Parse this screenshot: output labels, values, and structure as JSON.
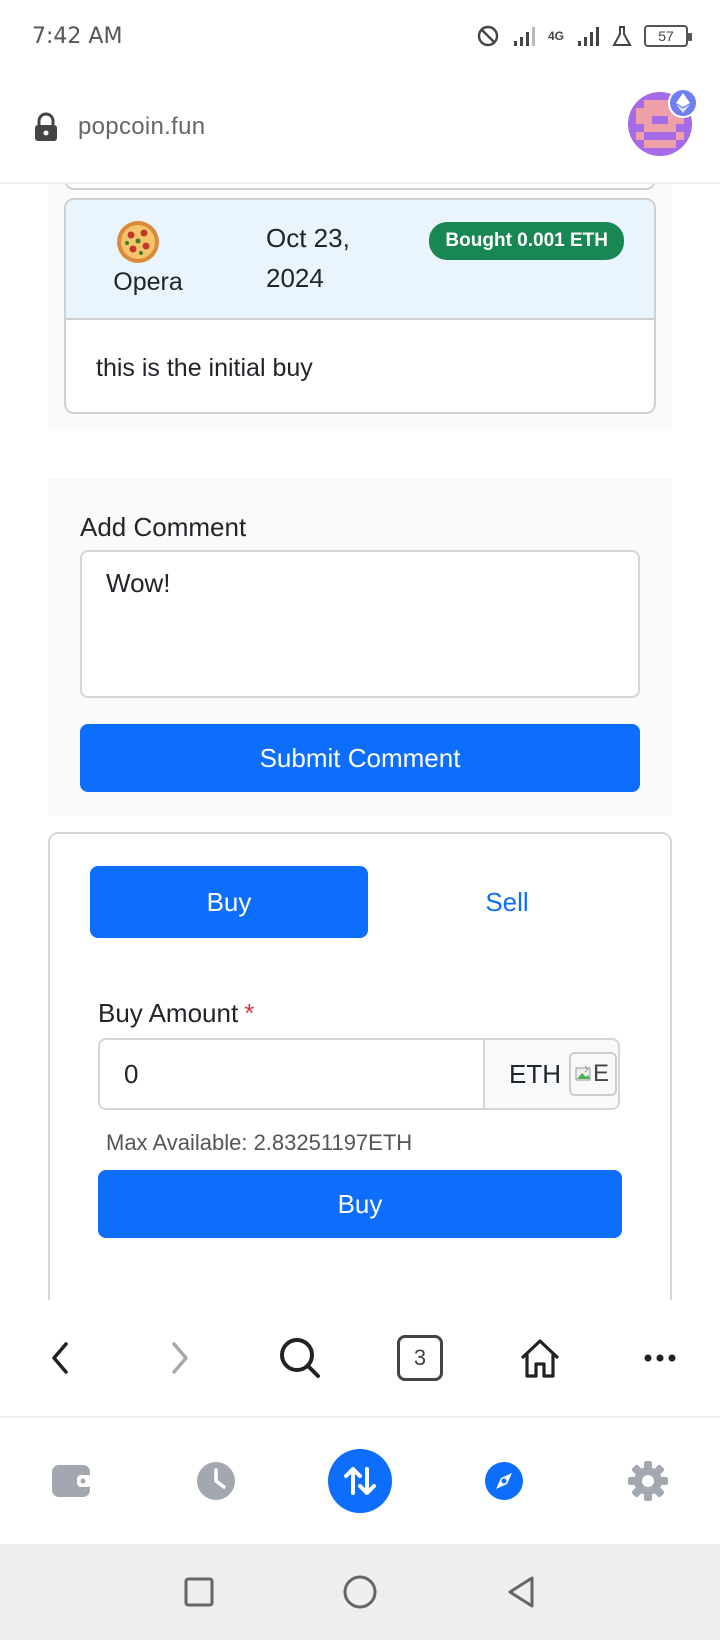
{
  "status_bar": {
    "time": "7:42 AM",
    "network_label": "4G",
    "battery": "57"
  },
  "browser": {
    "url": "popcoin.fun",
    "tab_count": "3"
  },
  "comment": {
    "user": "Opera",
    "date": "Oct 23, 2024",
    "badge": "Bought 0.001 ETH",
    "text": "this is the initial buy"
  },
  "add_comment": {
    "label": "Add Comment",
    "value": "Wow!",
    "submit_label": "Submit Comment"
  },
  "trade": {
    "tab_buy": "Buy",
    "tab_sell": "Sell",
    "amount_label": "Buy Amount",
    "required_mark": "*",
    "amount_value": "0",
    "currency": "ETH",
    "broken_image_alt": "E",
    "max_available": "Max Available: 2.83251197ETH",
    "submit_label": "Buy"
  },
  "colors": {
    "primary": "#0d6efd",
    "success": "#198754",
    "comment_header_bg": "#eaf4fd",
    "required": "#dc3545"
  }
}
